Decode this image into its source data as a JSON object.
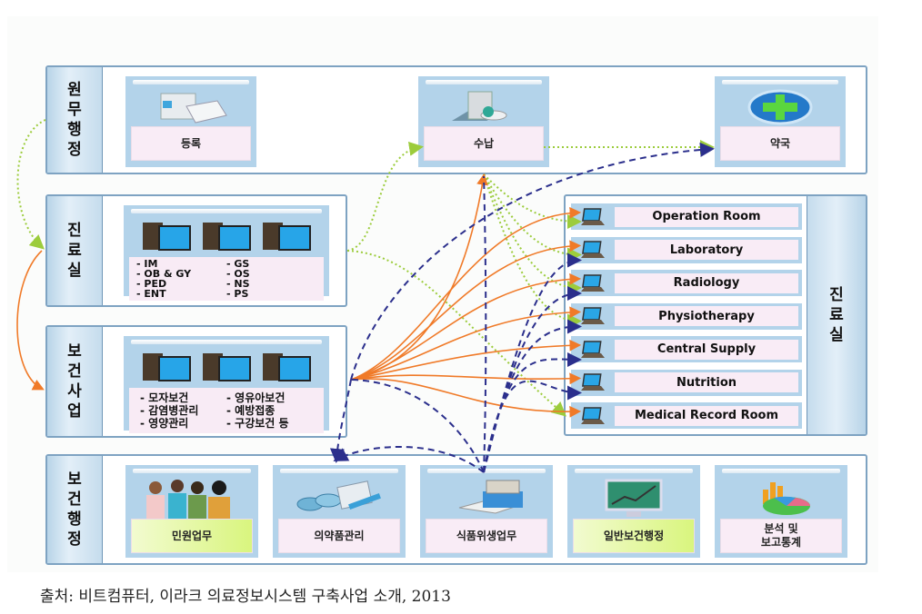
{
  "diagram": {
    "sections": {
      "admin": {
        "label": "원무행정",
        "tiles": [
          {
            "icon": "registration-printer-icon",
            "label": "등록"
          },
          {
            "icon": "payment-register-icon",
            "label": "수납"
          },
          {
            "icon": "pharmacy-plus-icon",
            "label": "약국"
          }
        ]
      },
      "clinic": {
        "label": "진료실",
        "icon": "workstation-computers-icon",
        "departments_left": [
          "- IM",
          "- OB & GY",
          "- PED",
          "- ENT"
        ],
        "departments_right": [
          "- GS",
          "- OS",
          "- NS",
          "- PS"
        ]
      },
      "public_health": {
        "label": "보건사업",
        "icon": "workstation-computers-icon",
        "programs_left": [
          "- 모자보건",
          "- 감염병관리",
          "- 영양관리"
        ],
        "programs_right": [
          "- 영유아보건",
          "- 예방접종",
          "- 구강보건 등"
        ]
      },
      "clinic_rooms": {
        "label": "진료실",
        "rooms": [
          "Operation Room",
          "Laboratory",
          "Radiology",
          "Physiotherapy",
          "Central Supply",
          "Nutrition",
          "Medical Record Room"
        ]
      },
      "health_admin": {
        "label": "보건행정",
        "tiles": [
          {
            "icon": "people-group-icon",
            "label": "민원업무",
            "highlight": true
          },
          {
            "icon": "medicine-supplies-icon",
            "label": "의약품관리",
            "highlight": false
          },
          {
            "icon": "food-hygiene-tray-icon",
            "label": "식품위생업무",
            "highlight": false
          },
          {
            "icon": "monitor-chart-icon",
            "label": "일반보건행정",
            "highlight": true
          },
          {
            "icon": "statistics-pie-icon",
            "label": "분석 및\n보고통계",
            "highlight": false
          }
        ]
      }
    },
    "connector_colors": {
      "green_dotted": "#9ccc3c",
      "orange_solid": "#f07a28",
      "navy_dashed": "#2b2f8c"
    },
    "source_caption": "출처: 비트컴퓨터, 이라크 의료정보시스템 구축사업 소개, 2013"
  }
}
